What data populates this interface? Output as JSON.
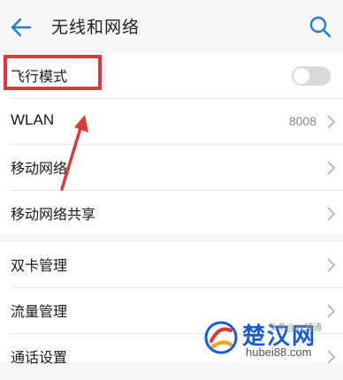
{
  "header": {
    "title": "无线和网络",
    "back_icon": "arrow-left-icon",
    "search_icon": "search-icon",
    "accent": "#1e7fd8"
  },
  "section1": {
    "items": [
      {
        "label": "飞行模式",
        "control": "toggle",
        "toggle_on": false
      },
      {
        "label": "WLAN",
        "value": "8008",
        "control": "chevron"
      },
      {
        "label": "移动网络",
        "control": "chevron"
      },
      {
        "label": "移动网络共享",
        "control": "chevron"
      }
    ]
  },
  "section2": {
    "items": [
      {
        "label": "双卡管理",
        "control": "chevron"
      },
      {
        "label": "流量管理",
        "control": "chevron"
      },
      {
        "label": "通话设置",
        "control": "chevron"
      }
    ]
  },
  "annotation": {
    "highlight_color": "#d93a3a"
  },
  "watermark": {
    "brand": "楚汉网",
    "domain": "hubei88.com",
    "note": "头条@W预通"
  }
}
